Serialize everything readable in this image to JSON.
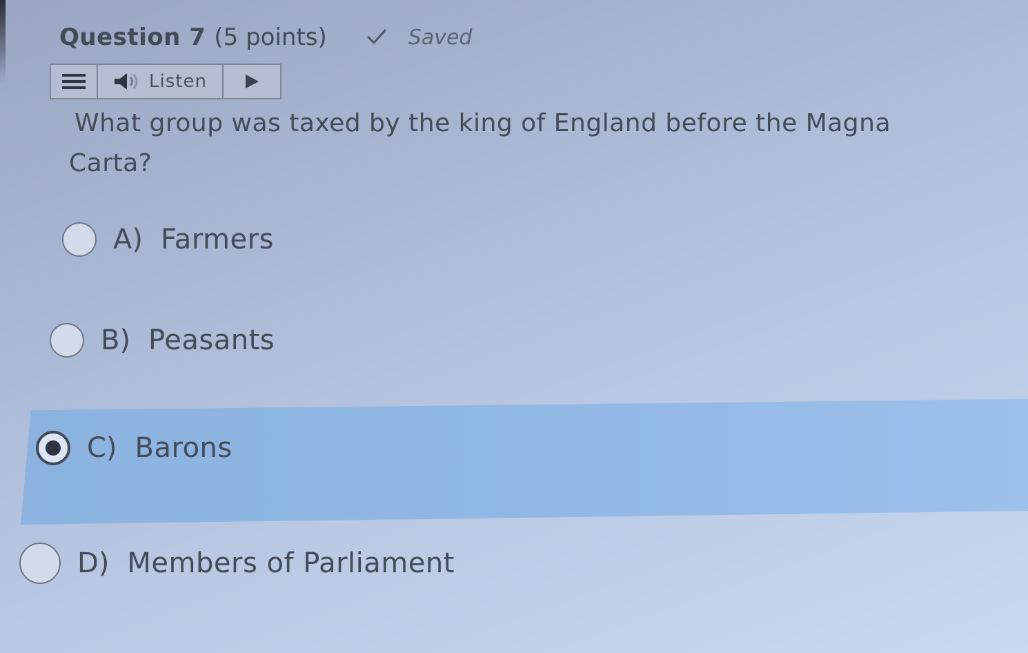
{
  "question": {
    "title": "Question 7",
    "points": "(5 points)",
    "status": "Saved",
    "text": "What group was taxed by the king of England before the Magna Carta?"
  },
  "toolbar": {
    "listen_label": "Listen"
  },
  "options": [
    {
      "letter": "A)",
      "text": "Farmers",
      "selected": false
    },
    {
      "letter": "B)",
      "text": "Peasants",
      "selected": false
    },
    {
      "letter": "C)",
      "text": "Barons",
      "selected": true
    },
    {
      "letter": "D)",
      "text": "Members of Parliament",
      "selected": false
    }
  ],
  "colors": {
    "selected_band": "#92b9e6",
    "text": "#434a58",
    "background": "#b9c7e2"
  },
  "icons": [
    "menu-icon",
    "speaker-icon",
    "play-icon",
    "checkmark-icon"
  ]
}
